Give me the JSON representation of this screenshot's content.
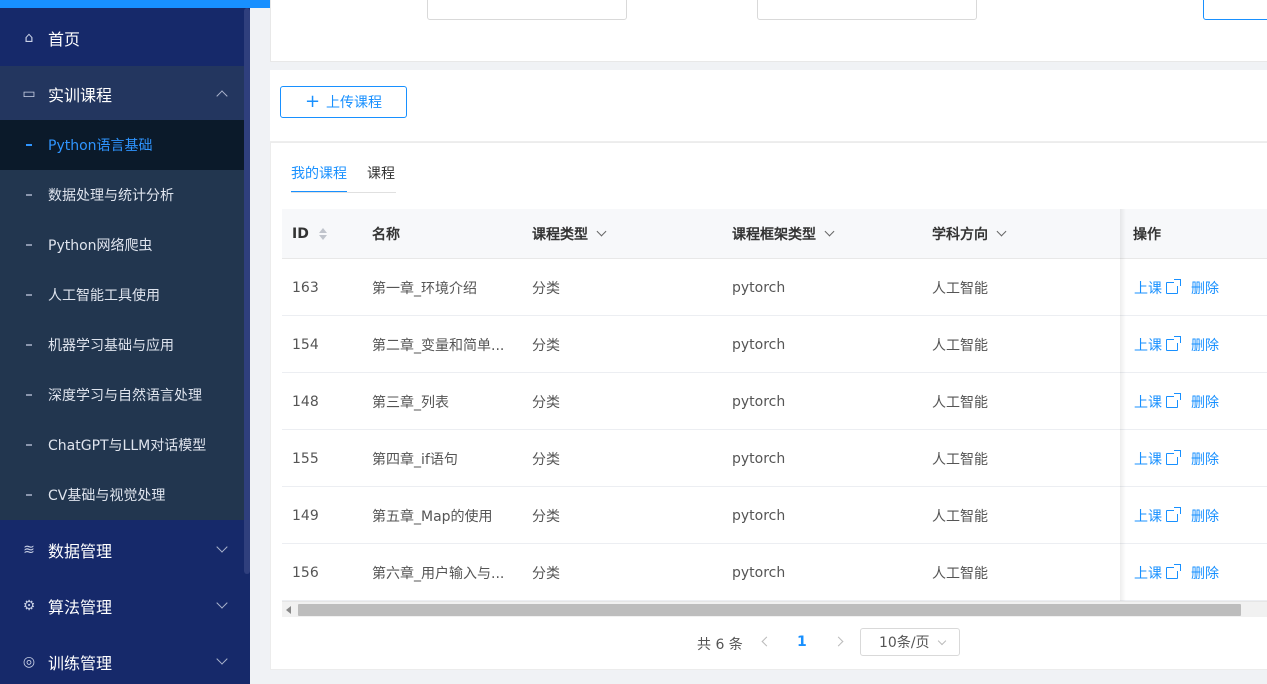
{
  "sidebar": {
    "home": {
      "label": "首页",
      "icon": "home-icon"
    },
    "training": {
      "label": "实训课程",
      "icon": "code-icon"
    },
    "sub_items": [
      {
        "label": "Python语言基础"
      },
      {
        "label": "数据处理与统计分析"
      },
      {
        "label": "Python网络爬虫"
      },
      {
        "label": "人工智能工具使用"
      },
      {
        "label": "机器学习基础与应用"
      },
      {
        "label": "深度学习与自然语言处理"
      },
      {
        "label": "ChatGPT与LLM对话模型"
      },
      {
        "label": "CV基础与视觉处理"
      }
    ],
    "data_mgmt": {
      "label": "数据管理",
      "icon": "database-icon"
    },
    "algo_mgmt": {
      "label": "算法管理",
      "icon": "gear-icon"
    },
    "train_mgmt": {
      "label": "训练管理",
      "icon": "train-icon"
    }
  },
  "toolbar": {
    "upload_label": "上传课程",
    "plus": "+"
  },
  "tabs": [
    {
      "label": "我的课程"
    },
    {
      "label": "课程"
    }
  ],
  "table": {
    "headers": {
      "id": "ID",
      "name": "名称",
      "type": "课程类型",
      "framework": "课程框架类型",
      "subject": "学科方向",
      "ops": "操作"
    },
    "rows": [
      {
        "id": "163",
        "name": "第一章_环境介绍",
        "type": "分类",
        "framework": "pytorch",
        "subject": "人工智能",
        "start": "上课",
        "delete": "删除"
      },
      {
        "id": "154",
        "name": "第二章_变量和简单...",
        "type": "分类",
        "framework": "pytorch",
        "subject": "人工智能",
        "start": "上课",
        "delete": "删除"
      },
      {
        "id": "148",
        "name": "第三章_列表",
        "type": "分类",
        "framework": "pytorch",
        "subject": "人工智能",
        "start": "上课",
        "delete": "删除"
      },
      {
        "id": "155",
        "name": "第四章_if语句",
        "type": "分类",
        "framework": "pytorch",
        "subject": "人工智能",
        "start": "上课",
        "delete": "删除"
      },
      {
        "id": "149",
        "name": "第五章_Map的使用",
        "type": "分类",
        "framework": "pytorch",
        "subject": "人工智能",
        "start": "上课",
        "delete": "删除"
      },
      {
        "id": "156",
        "name": "第六章_用户输入与...",
        "type": "分类",
        "framework": "pytorch",
        "subject": "人工智能",
        "start": "上课",
        "delete": "删除"
      }
    ]
  },
  "pagination": {
    "total": "共 6 条",
    "page": "1",
    "page_size": "10条/页"
  },
  "colors": {
    "accent": "#1890ff",
    "sidebar": "#16296a"
  }
}
